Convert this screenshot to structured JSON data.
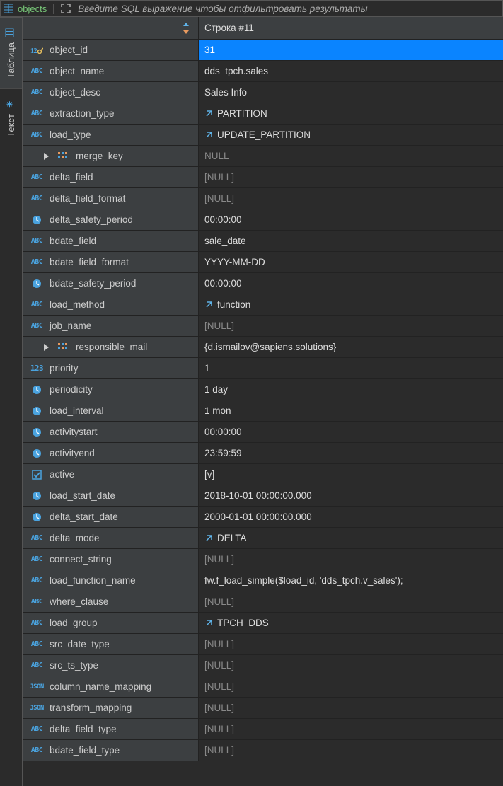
{
  "topbar": {
    "tab_label": "objects",
    "filter_hint": "Введите SQL выражение чтобы отфильтровать результаты"
  },
  "sidebar": {
    "tab_table": "Таблица",
    "tab_text": "Текст"
  },
  "header": {
    "row_label": "Строка  #11"
  },
  "rows": [
    {
      "type": "key",
      "name": "object_id",
      "value": "31",
      "selected": true
    },
    {
      "type": "abc",
      "name": "object_name",
      "value": "dds_tpch.sales"
    },
    {
      "type": "abc",
      "name": "object_desc",
      "value": "Sales Info"
    },
    {
      "type": "abc",
      "name": "extraction_type",
      "value": "PARTITION",
      "link": true
    },
    {
      "type": "abc",
      "name": "load_type",
      "value": "UPDATE_PARTITION",
      "link": true
    },
    {
      "type": "array",
      "name": "merge_key",
      "value": "NULL",
      "null": true,
      "indent": true,
      "expand": true
    },
    {
      "type": "abc",
      "name": "delta_field",
      "value": "[NULL]",
      "null": true
    },
    {
      "type": "abc",
      "name": "delta_field_format",
      "value": "[NULL]",
      "null": true
    },
    {
      "type": "clock",
      "name": "delta_safety_period",
      "value": "00:00:00"
    },
    {
      "type": "abc",
      "name": "bdate_field",
      "value": "sale_date"
    },
    {
      "type": "abc",
      "name": "bdate_field_format",
      "value": "YYYY-MM-DD"
    },
    {
      "type": "clock",
      "name": "bdate_safety_period",
      "value": "00:00:00"
    },
    {
      "type": "abc",
      "name": "load_method",
      "value": "function",
      "link": true
    },
    {
      "type": "abc",
      "name": "job_name",
      "value": "[NULL]",
      "null": true
    },
    {
      "type": "array",
      "name": "responsible_mail",
      "value": "{d.ismailov@sapiens.solutions}",
      "indent": true,
      "expand": true
    },
    {
      "type": "123",
      "name": "priority",
      "value": "1"
    },
    {
      "type": "clock",
      "name": "periodicity",
      "value": "1 day"
    },
    {
      "type": "clock",
      "name": "load_interval",
      "value": "1 mon"
    },
    {
      "type": "clock",
      "name": "activitystart",
      "value": "00:00:00"
    },
    {
      "type": "clock",
      "name": "activityend",
      "value": "23:59:59"
    },
    {
      "type": "check",
      "name": "active",
      "value": "[v]"
    },
    {
      "type": "clock",
      "name": "load_start_date",
      "value": "2018-10-01 00:00:00.000"
    },
    {
      "type": "clock",
      "name": "delta_start_date",
      "value": "2000-01-01 00:00:00.000"
    },
    {
      "type": "abc",
      "name": "delta_mode",
      "value": "DELTA",
      "link": true
    },
    {
      "type": "abc",
      "name": "connect_string",
      "value": "[NULL]",
      "null": true
    },
    {
      "type": "abc",
      "name": "load_function_name",
      "value": "fw.f_load_simple($load_id, 'dds_tpch.v_sales');"
    },
    {
      "type": "abc",
      "name": "where_clause",
      "value": "[NULL]",
      "null": true
    },
    {
      "type": "abc",
      "name": "load_group",
      "value": "TPCH_DDS",
      "link": true
    },
    {
      "type": "abc",
      "name": "src_date_type",
      "value": "[NULL]",
      "null": true
    },
    {
      "type": "abc",
      "name": "src_ts_type",
      "value": "[NULL]",
      "null": true
    },
    {
      "type": "json",
      "name": "column_name_mapping",
      "value": "[NULL]",
      "null": true
    },
    {
      "type": "json",
      "name": "transform_mapping",
      "value": "[NULL]",
      "null": true
    },
    {
      "type": "abc",
      "name": "delta_field_type",
      "value": "[NULL]",
      "null": true
    },
    {
      "type": "abc",
      "name": "bdate_field_type",
      "value": "[NULL]",
      "null": true
    }
  ]
}
